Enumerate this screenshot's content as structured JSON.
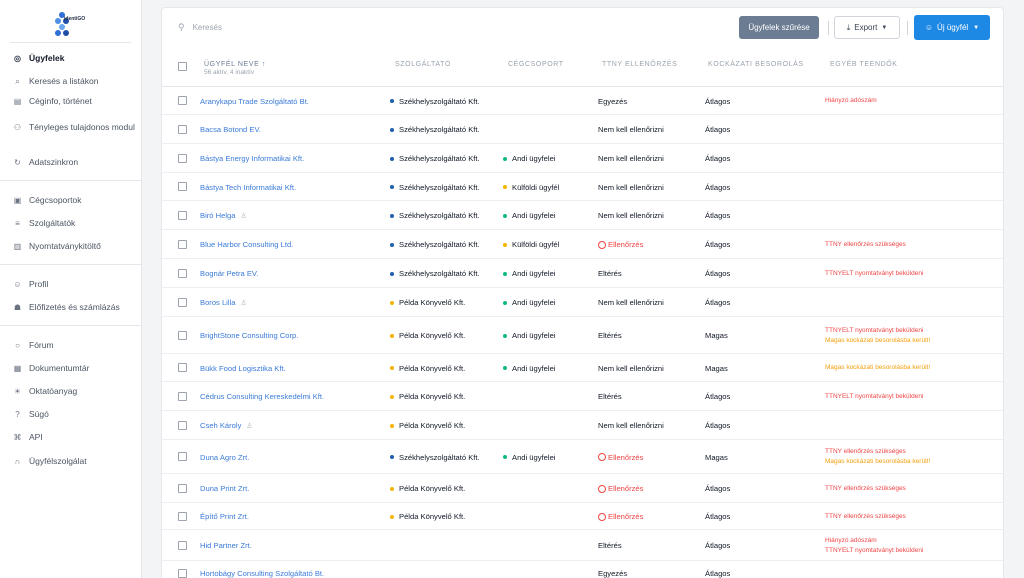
{
  "brand": {
    "logo_text": "identiGO"
  },
  "nav": {
    "group1": [
      {
        "label": "Ügyfelek",
        "icon": "clients-icon",
        "glyph": "◎",
        "active": true
      },
      {
        "label": "Keresés a listákon",
        "icon": "search-icon",
        "glyph": "⌕"
      },
      {
        "label": "Céginfo, történet",
        "icon": "calendar-icon",
        "glyph": "▤"
      },
      {
        "label": "Tényleges tulajdonos modul",
        "icon": "owners-icon",
        "glyph": "⚇"
      },
      {
        "label": "Adatszinkron",
        "icon": "sync-icon",
        "glyph": "↻"
      }
    ],
    "group2": [
      {
        "label": "Cégcsoportok",
        "icon": "archive-icon",
        "glyph": "▣"
      },
      {
        "label": "Szolgáltatók",
        "icon": "layers-icon",
        "glyph": "≡"
      },
      {
        "label": "Nyomtatványkitöltő",
        "icon": "document-icon",
        "glyph": "▥"
      }
    ],
    "group3": [
      {
        "label": "Profil",
        "icon": "user-icon",
        "glyph": "☺"
      },
      {
        "label": "Előfizetés és számlázás",
        "icon": "cart-icon",
        "glyph": "☗"
      }
    ],
    "group4": [
      {
        "label": "Fórum",
        "icon": "chat-icon",
        "glyph": "○"
      },
      {
        "label": "Dokumentumtár",
        "icon": "book-icon",
        "glyph": "▦"
      },
      {
        "label": "Oktatóanyag",
        "icon": "sun-icon",
        "glyph": "☀"
      },
      {
        "label": "Súgó",
        "icon": "help-icon",
        "glyph": "?"
      },
      {
        "label": "API",
        "icon": "command-icon",
        "glyph": "⌘"
      },
      {
        "label": "Ügyfélszolgálat",
        "icon": "headset-icon",
        "glyph": "∩"
      }
    ]
  },
  "toolbar": {
    "search_placeholder": "Keresés",
    "filter_label": "Ügyfelek szűrése",
    "export_label": "Export",
    "new_label": "Új ügyfél"
  },
  "table": {
    "headers": {
      "name": "Ügyfél neve ↑",
      "name_sub": "56 aktív, 4 inaktív",
      "provider": "Szolgáltató",
      "group": "Cégcsoport",
      "ttny": "TTNY ellenőrzés",
      "risk": "Kockázati besorolás",
      "todo": "Egyéb teendők"
    },
    "colors": {
      "provider_blue": "#1f5fae",
      "provider_yellow": "#f5b400",
      "group_green": "#10b981",
      "group_yellow": "#f5b400",
      "warn_red": "#ef4444",
      "warn_orange": "#f59e0b"
    },
    "rows": [
      {
        "name": "Aranykapu Trade Szolgáltató Bt.",
        "person": false,
        "provider": "Székhelyszolgáltató Kft.",
        "provider_color": "#1f5fae",
        "group": "",
        "group_color": "",
        "ttny": "Egyezés",
        "ttny_warn": false,
        "risk": "Átlagos",
        "todo": [
          {
            "text": "Hiányzó adószám",
            "color": "red"
          }
        ]
      },
      {
        "name": "Bacsa Botond EV.",
        "person": false,
        "provider": "Székhelyszolgáltató Kft.",
        "provider_color": "#1f5fae",
        "group": "",
        "group_color": "",
        "ttny": "Nem kell ellenőrizni",
        "ttny_warn": false,
        "risk": "Átlagos",
        "todo": []
      },
      {
        "name": "Bástya Energy Informatikai Kft.",
        "person": false,
        "provider": "Székhelyszolgáltató Kft.",
        "provider_color": "#1f5fae",
        "group": "Andi ügyfelei",
        "group_color": "#10b981",
        "ttny": "Nem kell ellenőrizni",
        "ttny_warn": false,
        "risk": "Átlagos",
        "todo": []
      },
      {
        "name": "Bástya Tech Informatikai Kft.",
        "person": false,
        "provider": "Székhelyszolgáltató Kft.",
        "provider_color": "#1f5fae",
        "group": "Külföldi ügyfél",
        "group_color": "#f5b400",
        "ttny": "Nem kell ellenőrizni",
        "ttny_warn": false,
        "risk": "Átlagos",
        "todo": []
      },
      {
        "name": "Biró Helga",
        "person": true,
        "provider": "Székhelyszolgáltató Kft.",
        "provider_color": "#1f5fae",
        "group": "Andi ügyfelei",
        "group_color": "#10b981",
        "ttny": "Nem kell ellenőrizni",
        "ttny_warn": false,
        "risk": "Átlagos",
        "todo": []
      },
      {
        "name": "Blue Harbor Consulting Ltd.",
        "person": false,
        "provider": "Székhelyszolgáltató Kft.",
        "provider_color": "#1f5fae",
        "group": "Külföldi ügyfél",
        "group_color": "#f5b400",
        "ttny": "Ellenőrzés",
        "ttny_warn": true,
        "risk": "Átlagos",
        "todo": [
          {
            "text": "TTNY ellenőrzés szükséges",
            "color": "red"
          }
        ]
      },
      {
        "name": "Bognár Petra EV.",
        "person": false,
        "provider": "Székhelyszolgáltató Kft.",
        "provider_color": "#1f5fae",
        "group": "Andi ügyfelei",
        "group_color": "#10b981",
        "ttny": "Eltérés",
        "ttny_warn": false,
        "risk": "Átlagos",
        "todo": [
          {
            "text": "TTNYELT nyomtatványt beküldeni",
            "color": "red"
          }
        ]
      },
      {
        "name": "Boros Lilla",
        "person": true,
        "provider": "Példa Könyvelő Kft.",
        "provider_color": "#f5b400",
        "group": "Andi ügyfelei",
        "group_color": "#10b981",
        "ttny": "Nem kell ellenőrizni",
        "ttny_warn": false,
        "risk": "Átlagos",
        "todo": []
      },
      {
        "name": "BrightStone Consulting Corp.",
        "person": false,
        "provider": "Példa Könyvelő Kft.",
        "provider_color": "#f5b400",
        "group": "Andi ügyfelei",
        "group_color": "#10b981",
        "ttny": "Eltérés",
        "ttny_warn": false,
        "risk": "Magas",
        "todo": [
          {
            "text": "TTNYELT nyomtatványt beküldeni",
            "color": "red"
          },
          {
            "text": "Magas kockázati besorolásba került!",
            "color": "orange"
          }
        ]
      },
      {
        "name": "Bükk Food Logisztika Kft.",
        "person": false,
        "provider": "Példa Könyvelő Kft.",
        "provider_color": "#f5b400",
        "group": "Andi ügyfelei",
        "group_color": "#10b981",
        "ttny": "Nem kell ellenőrizni",
        "ttny_warn": false,
        "risk": "Magas",
        "todo": [
          {
            "text": "Magas kockázati besorolásba került!",
            "color": "orange"
          }
        ]
      },
      {
        "name": "Cédrus Consulting Kereskedelmi Kft.",
        "person": false,
        "provider": "Példa Könyvelő Kft.",
        "provider_color": "#f5b400",
        "group": "",
        "group_color": "",
        "ttny": "Eltérés",
        "ttny_warn": false,
        "risk": "Átlagos",
        "todo": [
          {
            "text": "TTNYELT nyomtatványt beküldeni",
            "color": "red"
          }
        ]
      },
      {
        "name": "Cseh Károly",
        "person": true,
        "provider": "Példa Könyvelő Kft.",
        "provider_color": "#f5b400",
        "group": "",
        "group_color": "",
        "ttny": "Nem kell ellenőrizni",
        "ttny_warn": false,
        "risk": "Átlagos",
        "todo": []
      },
      {
        "name": "Duna Agro Zrt.",
        "person": false,
        "provider": "Székhelyszolgáltató Kft.",
        "provider_color": "#1f5fae",
        "group": "Andi ügyfelei",
        "group_color": "#10b981",
        "ttny": "Ellenőrzés",
        "ttny_warn": true,
        "risk": "Magas",
        "todo": [
          {
            "text": "TTNY ellenőrzés szükséges",
            "color": "red"
          },
          {
            "text": "Magas kockázati besorolásba került!",
            "color": "orange"
          }
        ]
      },
      {
        "name": "Duna Print Zrt.",
        "person": false,
        "provider": "Példa Könyvelő Kft.",
        "provider_color": "#f5b400",
        "group": "",
        "group_color": "",
        "ttny": "Ellenőrzés",
        "ttny_warn": true,
        "risk": "Átlagos",
        "todo": [
          {
            "text": "TTNY ellenőrzés szükséges",
            "color": "red"
          }
        ]
      },
      {
        "name": "Építő Print Zrt.",
        "person": false,
        "provider": "Példa Könyvelő Kft.",
        "provider_color": "#f5b400",
        "group": "",
        "group_color": "",
        "ttny": "Ellenőrzés",
        "ttny_warn": true,
        "risk": "Átlagos",
        "todo": [
          {
            "text": "TTNY ellenőrzés szükséges",
            "color": "red"
          }
        ]
      },
      {
        "name": "Hid Partner Zrt.",
        "person": false,
        "provider": "",
        "provider_color": "",
        "group": "",
        "group_color": "",
        "ttny": "Eltérés",
        "ttny_warn": false,
        "risk": "Átlagos",
        "todo": [
          {
            "text": "Hiányzó adószám",
            "color": "red"
          },
          {
            "text": "TTNYELT nyomtatványt beküldeni",
            "color": "red"
          }
        ]
      },
      {
        "name": "Hortobágy Consulting Szolgáltató Bt.",
        "person": false,
        "provider": "",
        "provider_color": "",
        "group": "",
        "group_color": "",
        "ttny": "Egyezés",
        "ttny_warn": false,
        "risk": "Átlagos",
        "todo": []
      }
    ]
  }
}
